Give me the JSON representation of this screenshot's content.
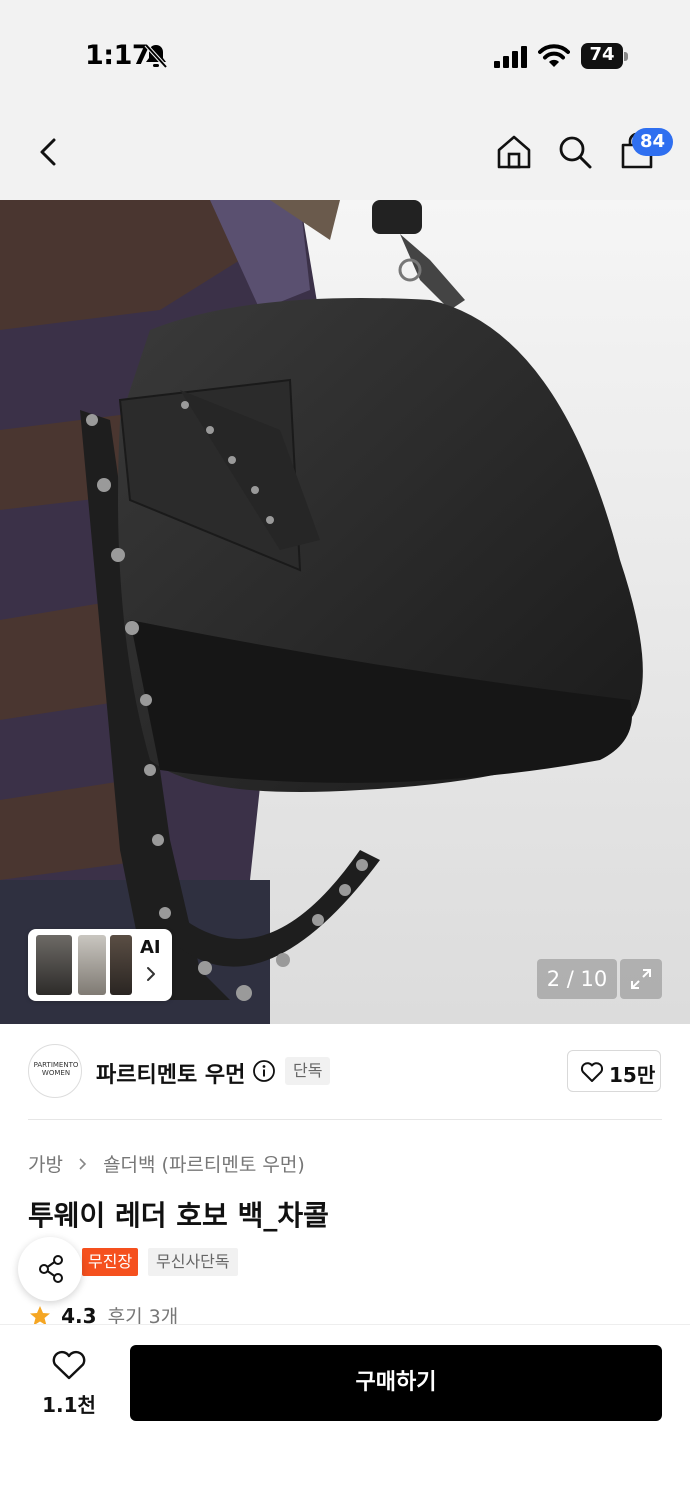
{
  "status_bar": {
    "time": "1:17",
    "battery": "74"
  },
  "header": {
    "cart_badge": "84"
  },
  "gallery": {
    "ai_label": "AI",
    "page_counter": "2 / 10"
  },
  "brand": {
    "logo_text_line1": "PARTIMENTO",
    "logo_text_line2": "WOMEN",
    "name": "파르티멘토 우먼",
    "exclusive_tag": "단독",
    "like_count": "15만"
  },
  "product": {
    "breadcrumb": [
      "가방",
      "숄더백 (파르티멘토 우먼)"
    ],
    "title": "투웨이 레더 호보 백_차콜",
    "badges": [
      "무진장",
      "무신사단독"
    ],
    "rating": "4.3",
    "review_count": "후기 3개"
  },
  "bottom_bar": {
    "wish_count": "1.1천",
    "buy_label": "구매하기"
  },
  "colors": {
    "accent_blue": "#2f6ff0",
    "badge_orange": "#f5501e",
    "rating_star": "#f5a623",
    "buy_button": "#000000"
  },
  "icons": [
    "back-icon",
    "home-icon",
    "search-icon",
    "cart-icon",
    "info-icon",
    "heart-icon",
    "share-icon",
    "star-icon",
    "expand-icon",
    "bell-off-icon",
    "signal-icon",
    "wifi-icon"
  ]
}
